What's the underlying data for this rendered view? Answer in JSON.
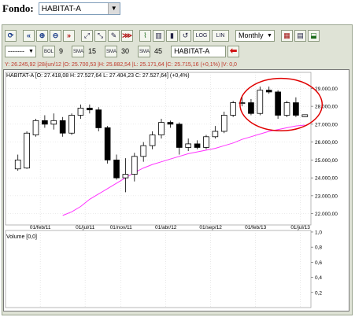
{
  "fondo": {
    "label": "Fondo:",
    "selected": "HABITAT-A"
  },
  "toolbar1": {
    "buttons": [
      "⟳",
      "«",
      "⊕",
      "⊖",
      "»",
      "⤢",
      "⤡",
      "✎",
      "⋙",
      "▥",
      "↺",
      "⬓"
    ],
    "loglin": [
      "LOG",
      "LIN"
    ],
    "period": "Monthly"
  },
  "toolbar2": {
    "style_select": "-------",
    "bol_label": "BOL",
    "bol_value": "9",
    "sma1_label": "SMA",
    "sma1_value": "15",
    "sma2_label": "SMA",
    "sma2_value": "30",
    "sma3_label": "SMA",
    "sma3_value": "45",
    "symbol": "HABITAT-A"
  },
  "cursor_info": "Y: 26.245,92 |28/jun/12 |O: 25.700,53 |H: 25.882,54 |L: 25.171,64 |C: 25.715,16 (+0,1%) |V: 0,0",
  "ohlc_info": "HABITAT-A [O: 27.418,08  H: 27.527,64  L: 27.404,23  C: 27.527,64] (+0,4%)",
  "volume_label": "Volume [0,0]",
  "colors": {
    "ma_line": "#ff33ff",
    "highlight": "#e00000",
    "up": "#ffffff",
    "down": "#000000"
  },
  "chart_data": {
    "type": "candlestick",
    "series_name": "HABITAT-A",
    "x_ticks": [
      "01/feb/11",
      "01/jul/11",
      "01/nov/11",
      "01/abr/12",
      "01/sep/12",
      "01/feb/13",
      "01/jul/13"
    ],
    "y_ticks": [
      "29.000,00",
      "28.000,00",
      "27.000,00",
      "26.000,00",
      "25.000,00",
      "24.000,00",
      "23.000,00",
      "22.000,00"
    ],
    "ylim": [
      21500,
      29500
    ],
    "volume_ticks": [
      "1,0",
      "0,8",
      "0,6",
      "0,4",
      "0,2"
    ],
    "candles": [
      {
        "o": 24500,
        "h": 25300,
        "l": 24400,
        "c": 25000
      },
      {
        "o": 24550,
        "h": 26600,
        "l": 24500,
        "c": 26500
      },
      {
        "o": 26400,
        "h": 27300,
        "l": 26300,
        "c": 27200
      },
      {
        "o": 27200,
        "h": 27500,
        "l": 26800,
        "c": 27000
      },
      {
        "o": 27000,
        "h": 27600,
        "l": 26700,
        "c": 27200
      },
      {
        "o": 27200,
        "h": 27400,
        "l": 26300,
        "c": 26500
      },
      {
        "o": 26500,
        "h": 27600,
        "l": 26400,
        "c": 27500
      },
      {
        "o": 27500,
        "h": 28100,
        "l": 27300,
        "c": 27900
      },
      {
        "o": 27900,
        "h": 28100,
        "l": 27600,
        "c": 27800
      },
      {
        "o": 27800,
        "h": 27950,
        "l": 26600,
        "c": 26800
      },
      {
        "o": 26800,
        "h": 26900,
        "l": 24800,
        "c": 25000
      },
      {
        "o": 25000,
        "h": 25300,
        "l": 23900,
        "c": 24000
      },
      {
        "o": 24000,
        "h": 25100,
        "l": 23200,
        "c": 24200
      },
      {
        "o": 24200,
        "h": 25400,
        "l": 23800,
        "c": 25200
      },
      {
        "o": 25200,
        "h": 26000,
        "l": 24900,
        "c": 25800
      },
      {
        "o": 25800,
        "h": 26600,
        "l": 25600,
        "c": 26400
      },
      {
        "o": 26400,
        "h": 27300,
        "l": 26200,
        "c": 27100
      },
      {
        "o": 27100,
        "h": 27200,
        "l": 26800,
        "c": 27000
      },
      {
        "o": 27000,
        "h": 27100,
        "l": 25300,
        "c": 25700
      },
      {
        "o": 25700,
        "h": 26200,
        "l": 25500,
        "c": 25900
      },
      {
        "o": 25900,
        "h": 26100,
        "l": 25600,
        "c": 25700
      },
      {
        "o": 25700,
        "h": 26400,
        "l": 25600,
        "c": 26300
      },
      {
        "o": 26300,
        "h": 26900,
        "l": 26200,
        "c": 26600
      },
      {
        "o": 26600,
        "h": 27700,
        "l": 26500,
        "c": 27500
      },
      {
        "o": 27500,
        "h": 28300,
        "l": 27400,
        "c": 28200
      },
      {
        "o": 28200,
        "h": 28600,
        "l": 28000,
        "c": 28200
      },
      {
        "o": 28200,
        "h": 28400,
        "l": 27500,
        "c": 27600
      },
      {
        "o": 27600,
        "h": 29100,
        "l": 27500,
        "c": 28900
      },
      {
        "o": 28900,
        "h": 29100,
        "l": 28700,
        "c": 28800
      },
      {
        "o": 28800,
        "h": 28900,
        "l": 27300,
        "c": 27500
      },
      {
        "o": 27500,
        "h": 28300,
        "l": 27400,
        "c": 28200
      },
      {
        "o": 28200,
        "h": 28500,
        "l": 27400,
        "c": 27500
      },
      {
        "o": 27418,
        "h": 27528,
        "l": 27404,
        "c": 27528
      }
    ],
    "ma": [
      null,
      null,
      null,
      null,
      null,
      21900,
      22100,
      22400,
      22800,
      23100,
      23400,
      23700,
      24000,
      24300,
      24550,
      24750,
      24900,
      25050,
      25200,
      25350,
      25450,
      25550,
      25650,
      25800,
      25950,
      26150,
      26300,
      26450,
      26600,
      26700,
      26800,
      26900,
      26950
    ]
  }
}
